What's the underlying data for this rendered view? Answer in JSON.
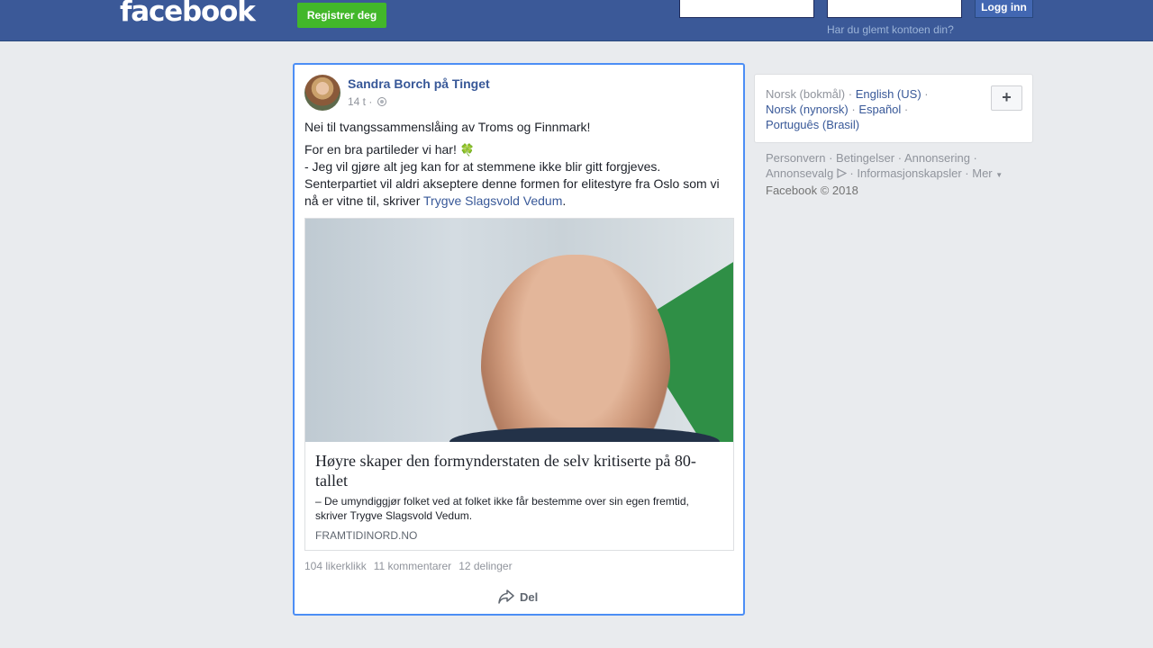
{
  "header": {
    "logo": "facebook",
    "register_label": "Registrer deg",
    "email_value": "",
    "password_value": "",
    "login_label": "Logg inn",
    "forgot_label": "Har du glemt kontoen din?"
  },
  "post": {
    "author": "Sandra Borch på Tinget",
    "time": "14 t ·",
    "line1": "Nei til tvangssammenslåing av Troms og Finnmark!",
    "line2a": "For en bra partileder vi har!",
    "line2b": "- Jeg vil gjøre alt jeg kan for at stemmene ikke blir gitt forgjeves.",
    "line2c": "Senterpartiet vil aldri akseptere denne formen for elitestyre fra Oslo som vi nå er vitne til, skriver",
    "mention": "Trygve Slagsvold Vedum",
    "period": ".",
    "card": {
      "title": "Høyre skaper den formynderstaten de selv kritiserte på 80-tallet",
      "description": "– De umyndiggjør folket ved at folket ikke får bestemme over sin egen fremtid, skriver Trygve Slagsvold Vedum.",
      "domain": "FRAMTIDINORD.NO"
    },
    "likes": "104 likerklikk",
    "comments": "11 kommentarer",
    "shares": "12 delinger",
    "share_label": "Del"
  },
  "sidebar": {
    "current_language": "Norsk (bokmål)",
    "languages": [
      "English (US)",
      "Norsk (nynorsk)",
      "Español",
      "Português (Brasil)"
    ],
    "plus_label": "+",
    "links": [
      "Personvern",
      "Betingelser",
      "Annonsering",
      "Annonsevalg",
      "Informasjonskapsler",
      "Mer"
    ],
    "copyright": "Facebook © 2018"
  }
}
